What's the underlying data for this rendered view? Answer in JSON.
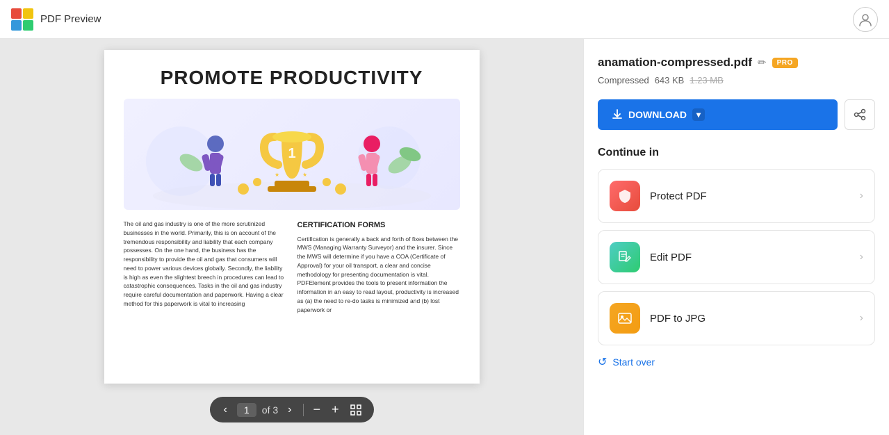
{
  "header": {
    "title": "PDF Preview",
    "logo_colors": [
      "red",
      "yellow",
      "blue",
      "green"
    ]
  },
  "pdf": {
    "title": "PROMOTE PRODUCTIVITY",
    "body_left": "The oil and gas industry is one of the more scrutinized businesses in the world. Primarily, this is on account of the tremendous responsibility and liability that each company possesses. On the one hand, the business has the responsibility to provide the oil and gas that consumers will need to power various devices globally. Secondly, the liability is high as even the slightest breech in procedures can lead to catastrophic consequences. Tasks in the oil and gas industry require careful documentation and paperwork. Having a clear method for this paperwork is vital to increasing",
    "body_right_title": "CERTIFICATION FORMS",
    "body_right": "Certification is generally a back and forth of fixes between the MWS (Managing Warranty Surveyor) and the insurer. Since the MWS will determine if you have a COA (Certificate of Approval) for your oil transport, a clear and concise methodology for presenting documentation is vital. PDFElement provides the tools to present information the information in an easy to read layout, productivity is increased as (a) the need to re-do tasks is minimized and (b) lost paperwork or"
  },
  "pagination": {
    "current_page": "1",
    "of_text": "of 3",
    "prev_label": "‹",
    "next_label": "›",
    "zoom_out_label": "−",
    "zoom_in_label": "+",
    "fit_label": "⊞"
  },
  "sidebar": {
    "file_name": "anamation-compressed.pdf",
    "compressed_label": "Compressed",
    "file_size": "643 KB",
    "file_size_original": "1.23 MB",
    "pro_badge": "PRO",
    "download_label": "DOWNLOAD",
    "continue_in_label": "Continue in",
    "actions": [
      {
        "id": "protect",
        "label": "Protect PDF",
        "icon": "🛡"
      },
      {
        "id": "edit",
        "label": "Edit PDF",
        "icon": "✏"
      },
      {
        "id": "jpg",
        "label": "PDF to JPG",
        "icon": "🖼"
      }
    ],
    "start_over_label": "Start over"
  }
}
